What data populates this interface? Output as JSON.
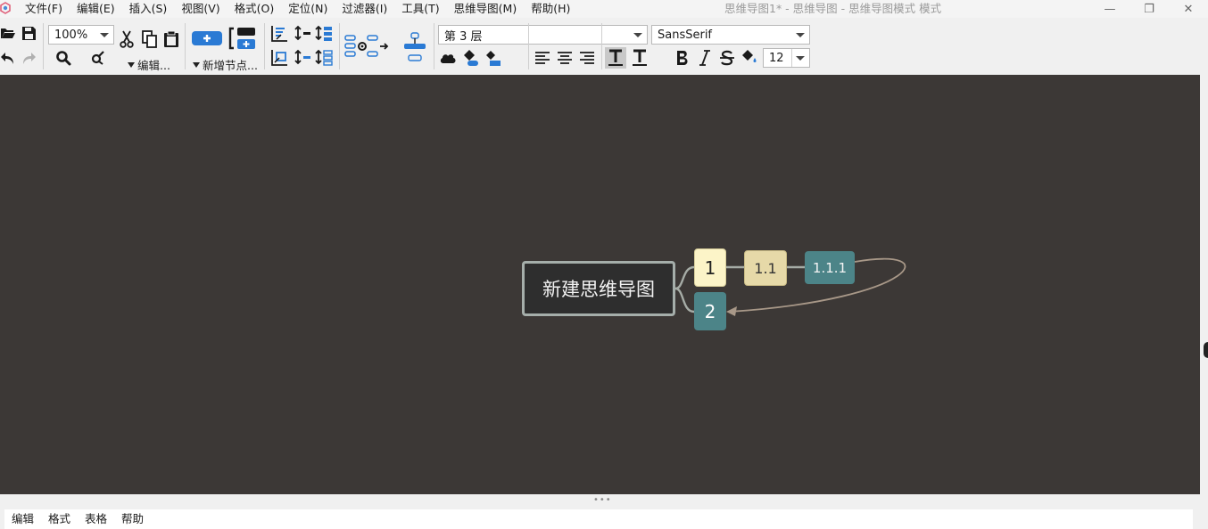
{
  "window": {
    "title": "思维导图1* - 思维导图 - 思维导图模式 模式",
    "min_glyph": "—",
    "max_glyph": "❐",
    "close_glyph": "✕"
  },
  "menu": [
    "文件(F)",
    "编辑(E)",
    "插入(S)",
    "视图(V)",
    "格式(O)",
    "定位(N)",
    "过滤器(I)",
    "工具(T)",
    "思维导图(M)",
    "帮助(H)"
  ],
  "toolbar": {
    "zoom": "100%",
    "edit_dropdown": "编辑...",
    "new_node_dropdown": "新增节点...",
    "level_select": "第 3 层",
    "font_family": "SansSerif",
    "font_size": "12",
    "icons": [
      "open-icon",
      "save-icon",
      "undo-icon",
      "redo-icon",
      "find-icon",
      "edit-node-icon",
      "cut-icon",
      "copy-icon",
      "paste-icon",
      "add-child-icon",
      "add-sibling-icon",
      "cloud-icon",
      "node-color-icon",
      "node-background-icon",
      "align-left-icon",
      "align-center-icon",
      "align-right-icon",
      "bold-icon",
      "italic-icon",
      "strikethrough-icon",
      "fill-color-icon"
    ]
  },
  "mindmap": {
    "root": "新建思维导图",
    "nodes": [
      {
        "id": "1",
        "label": "1",
        "children": [
          {
            "id": "1.1",
            "label": "1.1",
            "children": [
              {
                "id": "1.1.1",
                "label": "1.1.1"
              }
            ]
          }
        ]
      },
      {
        "id": "2",
        "label": "2"
      }
    ],
    "connector": {
      "from": "1.1.1",
      "to": "2"
    },
    "colors": {
      "canvas": "#3c3836",
      "root_bg": "#2e2e2e",
      "root_border": "#a5aeaa",
      "node1_bg": "#fcf4c8",
      "node11_bg": "#e6d9a8",
      "teal": "#4c8488",
      "edge": "#a6aca6",
      "connector": "#a89888"
    }
  },
  "bottom_tabs": [
    "编辑",
    "格式",
    "表格",
    "帮助"
  ]
}
